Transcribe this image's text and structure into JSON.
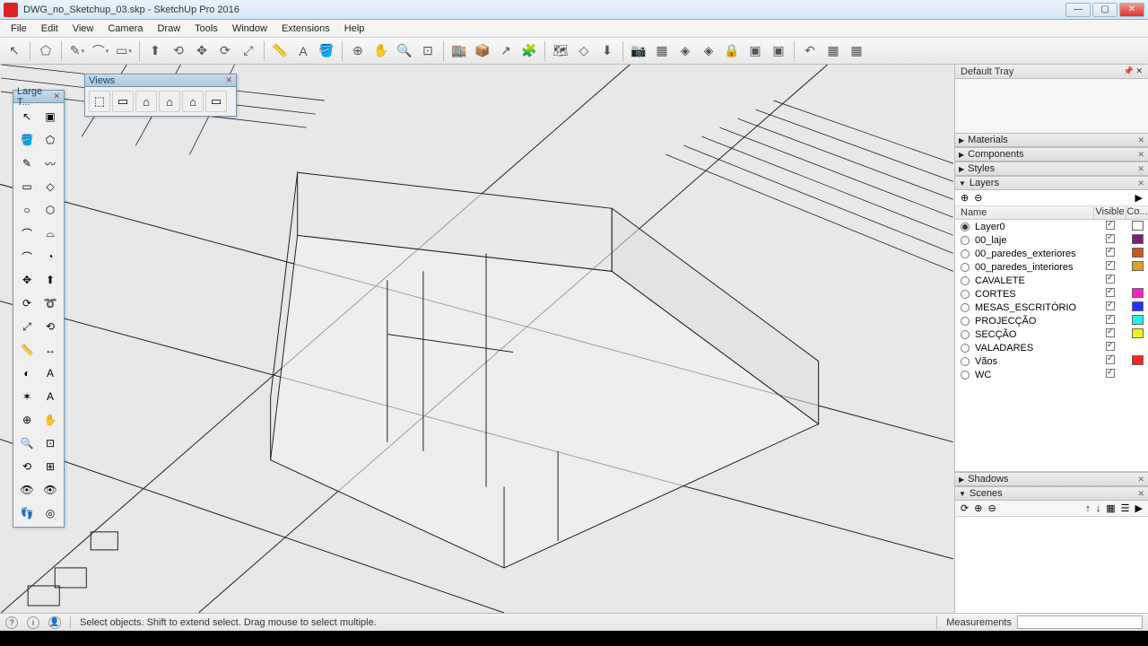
{
  "title": "DWG_no_Sketchup_03.skp - SketchUp Pro 2016",
  "menu": [
    "File",
    "Edit",
    "View",
    "Camera",
    "Draw",
    "Tools",
    "Window",
    "Extensions",
    "Help"
  ],
  "tray": {
    "title": "Default Tray"
  },
  "panels": {
    "materials": "Materials",
    "components": "Components",
    "styles": "Styles",
    "layers": "Layers",
    "shadows": "Shadows",
    "scenes": "Scenes"
  },
  "layers_head": {
    "name": "Name",
    "visible": "Visible",
    "color": "Co..."
  },
  "layers": [
    {
      "name": "Layer0",
      "active": true,
      "color": "#ffffff"
    },
    {
      "name": "00_laje",
      "active": false,
      "color": "#7a1f7a"
    },
    {
      "name": "00_paredes_exteriores",
      "active": false,
      "color": "#c65a1a"
    },
    {
      "name": "00_paredes_interiores",
      "active": false,
      "color": "#e0a020"
    },
    {
      "name": "CAVALETE",
      "active": false,
      "color": ""
    },
    {
      "name": "CORTES",
      "active": false,
      "color": "#ff20c0"
    },
    {
      "name": "MESAS_ESCRITÓRIO",
      "active": false,
      "color": "#2030ff"
    },
    {
      "name": "PROJECÇÃO",
      "active": false,
      "color": "#20f0f0"
    },
    {
      "name": "SECÇÃO",
      "active": false,
      "color": "#f0f020"
    },
    {
      "name": "VALADARES",
      "active": false,
      "color": ""
    },
    {
      "name": "Vãos",
      "active": false,
      "color": "#ff2020"
    },
    {
      "name": "WC",
      "active": false,
      "color": ""
    }
  ],
  "views_title": "Views",
  "large_title": "Large T...",
  "status": {
    "hint": "Select objects. Shift to extend select. Drag mouse to select multiple.",
    "meas": "Measurements"
  }
}
